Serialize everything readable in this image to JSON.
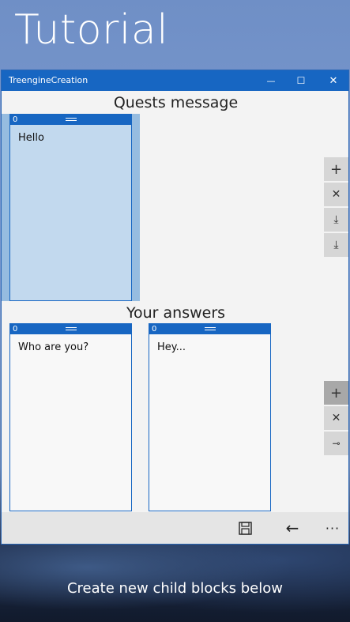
{
  "page": {
    "title": "Tutorial",
    "caption": "Create new child blocks below"
  },
  "window": {
    "app_name": "TreengineCreation",
    "controls": {
      "minimize": "—",
      "maximize": "☐",
      "close": "✕"
    }
  },
  "quests": {
    "title": "Quests message",
    "blocks": [
      {
        "number": "0",
        "text": "Hello"
      }
    ],
    "side_buttons": [
      {
        "icon": "plus-icon",
        "glyph": "+"
      },
      {
        "icon": "close-icon",
        "glyph": "✕"
      },
      {
        "icon": "download-icon",
        "glyph": "⤓"
      },
      {
        "icon": "download-icon",
        "glyph": "⤓"
      }
    ]
  },
  "answers": {
    "title": "Your answers",
    "blocks": [
      {
        "number": "0",
        "text": "Who are you?"
      },
      {
        "number": "0",
        "text": "Hey..."
      }
    ],
    "side_buttons": [
      {
        "icon": "plus-icon",
        "glyph": "+"
      },
      {
        "icon": "close-icon",
        "glyph": "✕"
      },
      {
        "icon": "link-icon",
        "glyph": "⊸"
      }
    ]
  },
  "bottom_bar": {
    "save": {
      "icon": "save-icon"
    },
    "back": {
      "icon": "back-arrow-icon",
      "glyph": "←"
    },
    "more": {
      "icon": "more-icon",
      "glyph": "···"
    }
  }
}
